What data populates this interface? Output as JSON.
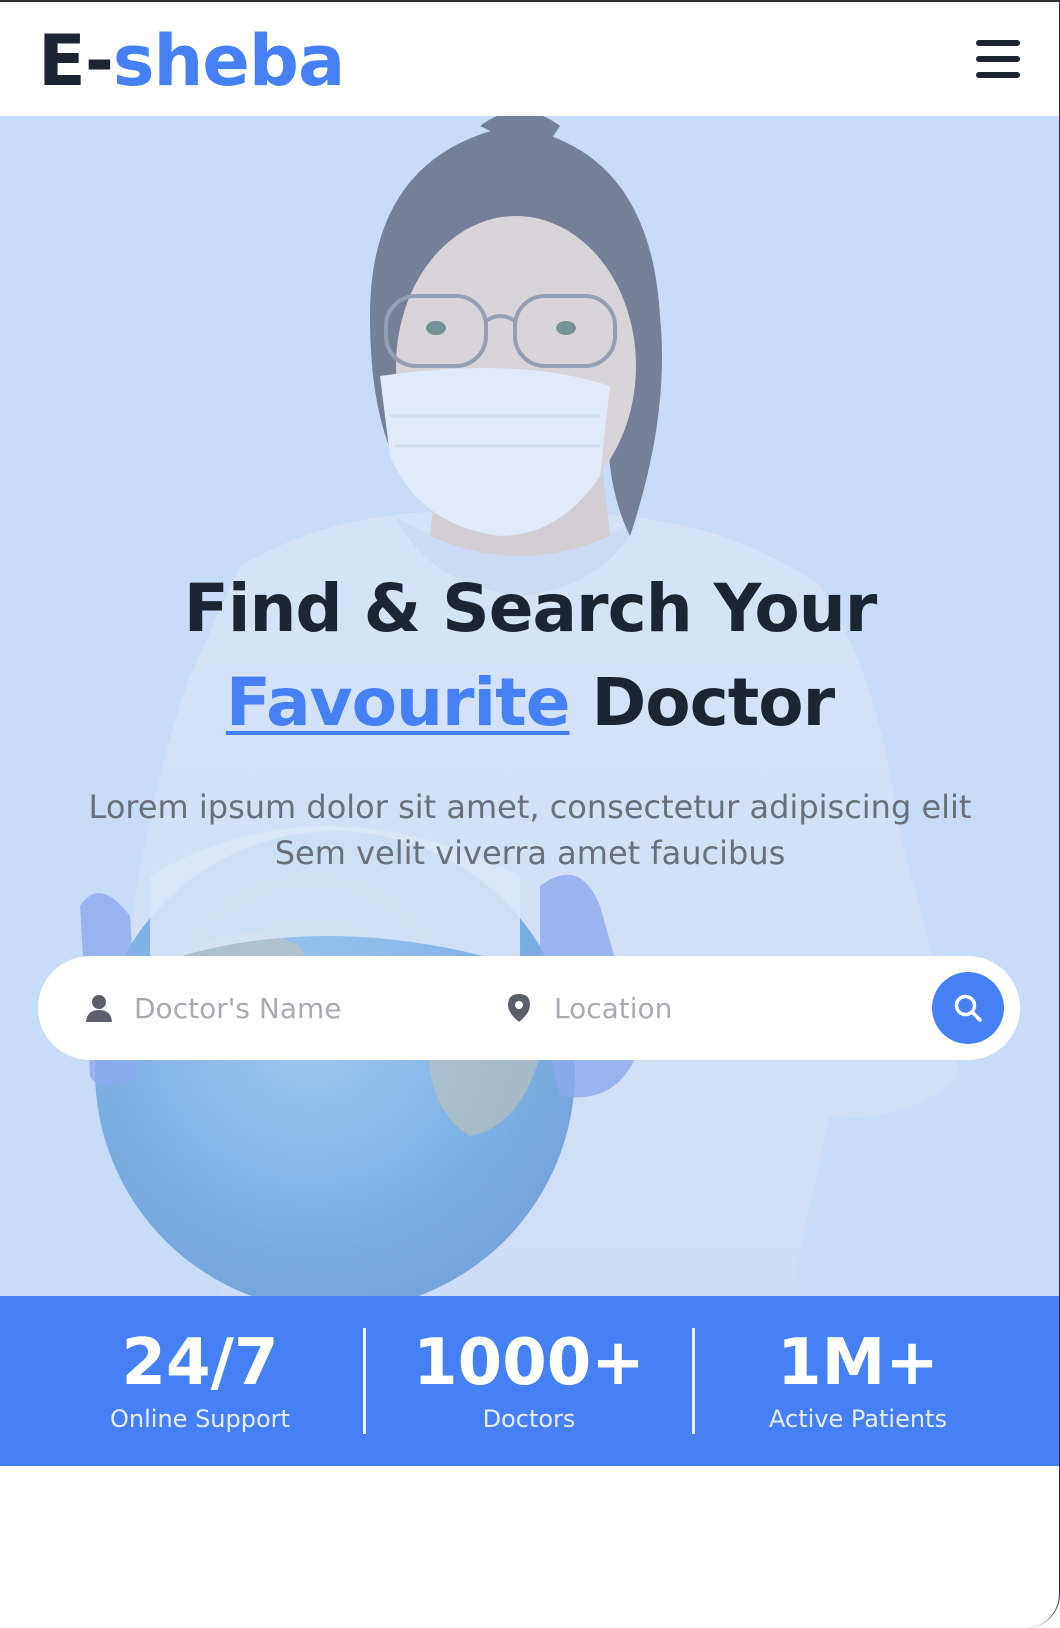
{
  "brand": {
    "prefix": "E-",
    "name": "sheba",
    "accent_color": "#4680f6",
    "dark_color": "#1e2532"
  },
  "header": {
    "menu_icon": "hamburger-menu-icon"
  },
  "hero": {
    "title_line1": "Find & Search Your",
    "title_highlight": "Favourite",
    "title_rest": "Doctor",
    "subtitle_line1": "Lorem ipsum dolor sit amet, consectetur adipiscing elit",
    "subtitle_line2": "Sem velit viverra amet faucibus",
    "photo_alt": "doctor-with-globe-photo",
    "tint_color": "#c6dcf9"
  },
  "search": {
    "name_placeholder": "Doctor's Name",
    "name_icon": "user-icon",
    "location_placeholder": "Location",
    "location_icon": "location-pin-icon",
    "button_icon": "search-icon"
  },
  "stats": [
    {
      "value": "24/7",
      "label": "Online Support"
    },
    {
      "value": "1000+",
      "label": "Doctors"
    },
    {
      "value": "1M+",
      "label": "Active Patients"
    }
  ]
}
